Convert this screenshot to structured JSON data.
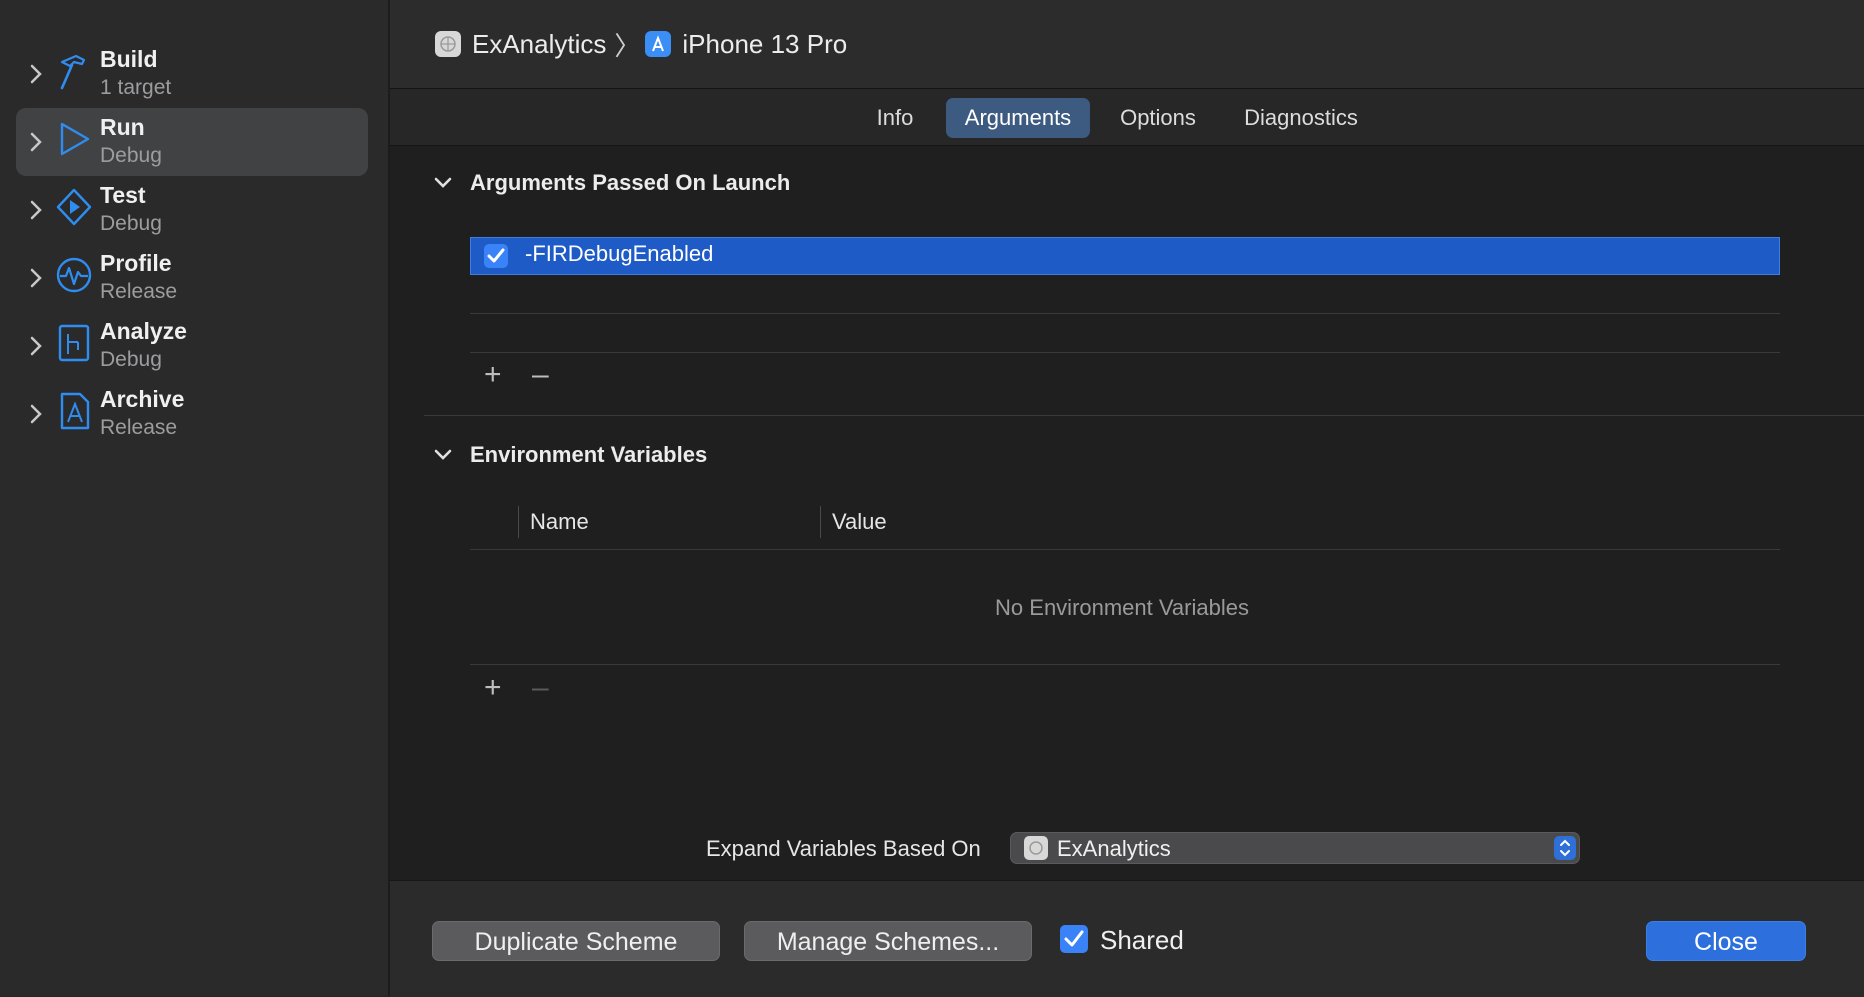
{
  "sidebar": {
    "items": [
      {
        "title": "Build",
        "subtitle": "1 target",
        "icon": "hammer-icon"
      },
      {
        "title": "Run",
        "subtitle": "Debug",
        "icon": "play-icon",
        "selected": true
      },
      {
        "title": "Test",
        "subtitle": "Debug",
        "icon": "test-diamond-icon"
      },
      {
        "title": "Profile",
        "subtitle": "Release",
        "icon": "waveform-icon"
      },
      {
        "title": "Analyze",
        "subtitle": "Debug",
        "icon": "analyze-icon"
      },
      {
        "title": "Archive",
        "subtitle": "Release",
        "icon": "archive-icon"
      }
    ]
  },
  "header": {
    "scheme": "ExAnalytics",
    "separator": "〉",
    "destination": "iPhone 13 Pro"
  },
  "tabs": [
    {
      "label": "Info"
    },
    {
      "label": "Arguments",
      "active": true
    },
    {
      "label": "Options"
    },
    {
      "label": "Diagnostics"
    }
  ],
  "arguments": {
    "section_title": "Arguments Passed On Launch",
    "items": [
      {
        "value": "-FIRDebugEnabled",
        "checked": true
      }
    ]
  },
  "environment": {
    "section_title": "Environment Variables",
    "columns": [
      "Name",
      "Value"
    ],
    "empty_message": "No Environment Variables"
  },
  "expand": {
    "label": "Expand Variables Based On",
    "selected": "ExAnalytics"
  },
  "footer": {
    "duplicate_label": "Duplicate Scheme",
    "manage_label": "Manage Schemes...",
    "shared_label": "Shared",
    "shared_checked": true,
    "close_label": "Close"
  },
  "colors": {
    "accent": "#2d6fdc",
    "selection": "#1e5bc6",
    "icon_blue": "#2f8cf0"
  }
}
